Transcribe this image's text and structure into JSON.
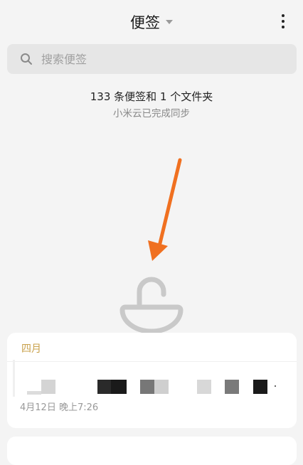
{
  "header": {
    "title": "便签"
  },
  "search": {
    "placeholder": "搜索便签"
  },
  "summary": {
    "count_text": "133 条便签和 1 个文件夹",
    "sync_text": "小米云已完成同步"
  },
  "notes": {
    "month_label": "四月",
    "items": [
      {
        "time": "4月12日 晚上7:26"
      }
    ]
  },
  "icons": {
    "caret": "caret-down-icon",
    "more": "more-vertical-icon",
    "search": "search-icon",
    "lock": "lock-icon",
    "arrow": "arrow-pointer"
  },
  "colors": {
    "background": "#f4f4f4",
    "search_bg": "#e6e6e6",
    "accent_month": "#c8a04a",
    "arrow": "#f07020",
    "lock": "#c9c9c9"
  }
}
